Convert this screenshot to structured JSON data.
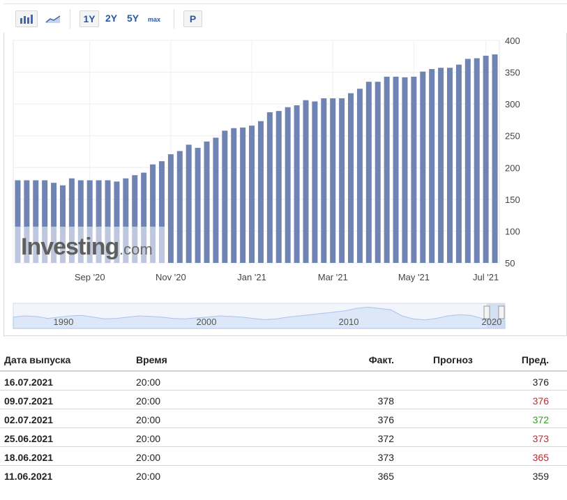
{
  "toolbar": {
    "bar_chart_icon": "bar-chart-icon",
    "line_chart_icon": "line-chart-icon",
    "range_1y": "1Y",
    "range_2y": "2Y",
    "range_5y": "5Y",
    "range_max": "max",
    "p_button": "P"
  },
  "watermark": {
    "brand": "Investing",
    "suffix": ".com"
  },
  "navigator": {
    "labels": [
      "1990",
      "2000",
      "2010",
      "2020"
    ]
  },
  "chart_data": {
    "type": "bar",
    "title": "",
    "xlabel": "",
    "ylabel": "",
    "ylim": [
      50,
      400
    ],
    "yticks": [
      50,
      100,
      150,
      200,
      250,
      300,
      350,
      400
    ],
    "y_axis_position": "right",
    "grid": true,
    "x_tick_labels": [
      "Sep '20",
      "Nov '20",
      "Jan '21",
      "Mar '21",
      "May '21",
      "Jul '21"
    ],
    "bar_color": "#6f84b3",
    "values": [
      180,
      180,
      180,
      180,
      176,
      172,
      183,
      180,
      180,
      180,
      180,
      178,
      183,
      188,
      192,
      205,
      210,
      221,
      226,
      236,
      231,
      241,
      247,
      258,
      262,
      263,
      266,
      273,
      287,
      289,
      295,
      298,
      306,
      304,
      309,
      309,
      309,
      317,
      324,
      335,
      335,
      343,
      343,
      342,
      343,
      351,
      355,
      357,
      357,
      362,
      371,
      372,
      376,
      378
    ]
  },
  "table": {
    "headers": {
      "date": "Дата выпуска",
      "time": "Время",
      "actual": "Факт.",
      "forecast": "Прогноз",
      "previous": "Пред."
    },
    "rows": [
      {
        "date": "16.07.2021",
        "time": "20:00",
        "actual": "",
        "forecast": "",
        "previous": "376",
        "prev_color": "#222222"
      },
      {
        "date": "09.07.2021",
        "time": "20:00",
        "actual": "378",
        "forecast": "",
        "previous": "376",
        "prev_color": "#c0282c"
      },
      {
        "date": "02.07.2021",
        "time": "20:00",
        "actual": "376",
        "forecast": "",
        "previous": "372",
        "prev_color": "#3a9a2a"
      },
      {
        "date": "25.06.2021",
        "time": "20:00",
        "actual": "372",
        "forecast": "",
        "previous": "373",
        "prev_color": "#c0282c"
      },
      {
        "date": "18.06.2021",
        "time": "20:00",
        "actual": "373",
        "forecast": "",
        "previous": "365",
        "prev_color": "#c0282c"
      },
      {
        "date": "11.06.2021",
        "time": "20:00",
        "actual": "365",
        "forecast": "",
        "previous": "359",
        "prev_color": "#222222"
      }
    ]
  }
}
